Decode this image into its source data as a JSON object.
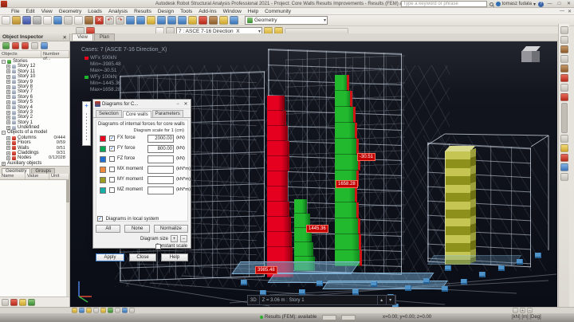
{
  "window": {
    "title": "Autodesk Robot Structural Analysis Professional 2021 - Project: Core Walls Results Improvements - Results (FEM) available",
    "search_placeholder": "Type a keyword or phrase",
    "account_name": "tomasz fudala"
  },
  "icons": {
    "minimize": "—",
    "maximize": "□",
    "close": "✕",
    "doc_minimize": "—",
    "doc_close": "✕",
    "plus": "+",
    "minus": "−",
    "spin_up": "▴",
    "spin_down": "▾",
    "help": "?"
  },
  "menu": {
    "items": [
      "File",
      "Edit",
      "View",
      "Geometry",
      "Loads",
      "Analysis",
      "Results",
      "Design",
      "Tools",
      "Add-Ins",
      "Window",
      "Help",
      "Community"
    ]
  },
  "toolbars": {
    "geometry_combo": "Geometry",
    "case_combo": "7 : ASCE 7-16 Direction_X"
  },
  "view_tabs": {
    "view": "View",
    "plan": "Plan"
  },
  "object_inspector": {
    "title": "Object Inspector",
    "col_objects": "Objects",
    "col_number": "Number of...",
    "stories_root": "Stories",
    "stories": [
      "Story 12",
      "Story 11",
      "Story 10",
      "Story 9",
      "Story 8",
      "Story 7",
      "Story 6",
      "Story 5",
      "Story 4",
      "Story 3",
      "Story 2",
      "Story 1",
      "Undefined"
    ],
    "model_root": "Objects of a model",
    "model_objects": [
      {
        "label": "Columns",
        "count": "0/444"
      },
      {
        "label": "Floors",
        "count": "0/59"
      },
      {
        "label": "Walls",
        "count": "0/51"
      },
      {
        "label": "Claddings",
        "count": "0/31"
      },
      {
        "label": "Nodes",
        "count": "0/12028"
      }
    ],
    "auxiliary_root": "Auxiliary objects",
    "tab_geometry": "Geometry",
    "tab_groups": "Groups",
    "table_cols": [
      "Name",
      "Value",
      "Unit"
    ]
  },
  "viewport": {
    "case_header": "Cases: 7 (ASCE 7-16 Direction_X)",
    "legend": [
      {
        "name": "WFx",
        "scale": "500kN",
        "min": "Min=-3985.48",
        "max": "Max=-30.51",
        "color": "#e8001d"
      },
      {
        "name": "WFy",
        "scale": "100kN",
        "min": "Min=-1445.36",
        "max": "Max=1658.28",
        "color": "#1db32b"
      }
    ],
    "labels": {
      "l1": "-30.51",
      "l2": "1658.28",
      "l3": "1445.36",
      "l4": "3985.48"
    },
    "nav_mode": "3D",
    "nav_level": "Z = 3.06 m : Story 1"
  },
  "dialog": {
    "title": "Diagrams for C...",
    "tabs": [
      "Selection",
      "Core walls",
      "Parameters"
    ],
    "group_title": "Diagrams of internal forces for core walls",
    "scale_hint": "Diagram scale for 1 (cm)",
    "rows": [
      {
        "color": "#e8001d",
        "label": "FX force",
        "checked": true,
        "value": "2000.00",
        "unit": "(kN)"
      },
      {
        "color": "#00a651",
        "label": "FY force",
        "checked": true,
        "value": "800.00",
        "unit": "(kN)"
      },
      {
        "color": "#1f6fd0",
        "label": "FZ force",
        "checked": false,
        "value": "",
        "unit": "(kN)"
      },
      {
        "color": "#f0883c",
        "label": "MX moment",
        "checked": false,
        "value": "",
        "unit": "(kN*m)"
      },
      {
        "color": "#9c9c20",
        "label": "MY moment",
        "checked": false,
        "value": "",
        "unit": "(kN*m)"
      },
      {
        "color": "#14b0a8",
        "label": "MZ moment",
        "checked": false,
        "value": "",
        "unit": "(kN*m)"
      }
    ],
    "local_system_label": "Diagrams in local system",
    "local_system_checked": true,
    "btn_all": "All",
    "btn_none": "None",
    "btn_normalize": "Normalize",
    "diagram_size_label": "Diagram size",
    "constant_scale_label": "Constant scale",
    "constant_scale_checked": false,
    "btn_apply": "Apply",
    "btn_close": "Close",
    "btn_help": "Help"
  },
  "status_bar": {
    "results": "Results (FEM): available",
    "coords": "x=0.00; y=0.00; z=0.00",
    "units": "[kN]  [m]  [Deg]"
  }
}
